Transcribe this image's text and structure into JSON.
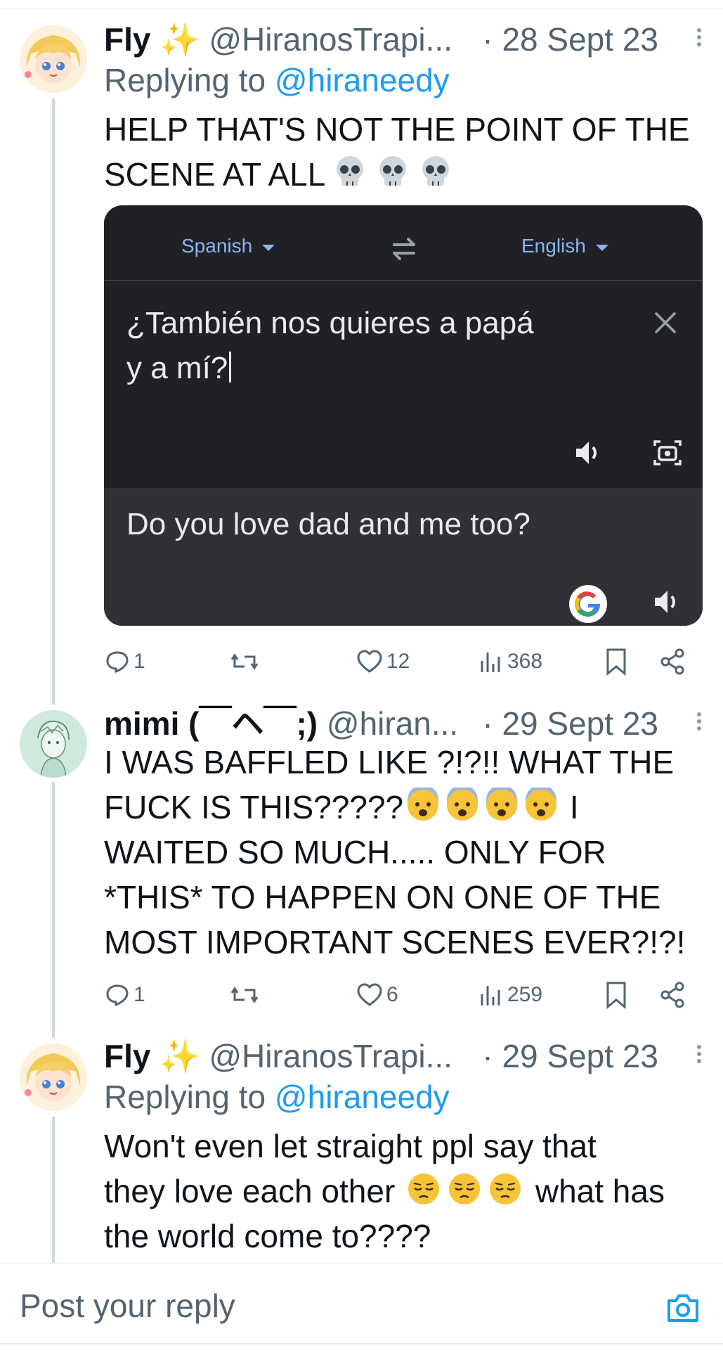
{
  "tweets": [
    {
      "name": "Fly ✨",
      "handle": "@HiranosTrapi...",
      "date": "· 28 Sept 23",
      "reply_label": "Replying to ",
      "reply_handle": "@hiraneedy",
      "text_line1": "HELP THAT'S NOT THE POINT OF THE",
      "text_line2": "SCENE AT ALL",
      "emoji": "skull",
      "stats": {
        "replies": "1",
        "likes": "12",
        "views": "368"
      }
    },
    {
      "name": "mimi (￣ヘ￣;)",
      "handle": "@hiran...",
      "date": "· 29 Sept 23",
      "text_line1": "I WAS BAFFLED LIKE ?!?!! WHAT THE",
      "text_line2a": "FUCK IS THIS?????",
      "text_line2b": " I",
      "text_line3": "WAITED SO MUCH..... ONLY FOR",
      "text_line4": "*THIS* TO HAPPEN ON ONE OF THE",
      "text_line5": "MOST IMPORTANT SCENES EVER?!?!",
      "emoji": "anxious-face",
      "stats": {
        "replies": "1",
        "likes": "6",
        "views": "259"
      }
    },
    {
      "name": "Fly ✨",
      "handle": "@HiranosTrapi...",
      "date": "· 29 Sept 23",
      "reply_label": "Replying to ",
      "reply_handle": "@hiraneedy",
      "text_line1": "Won't even let straight ppl say that",
      "text_line2a": "they love each other ",
      "text_line2b": " what has",
      "text_line3": "the world come to????",
      "emoji": "pensive-face"
    }
  ],
  "translate_card": {
    "source_lang": "Spanish",
    "target_lang": "English",
    "source_line1": "¿También nos quieres a papá",
    "source_line2": "y a mí?",
    "result": "Do you love dad and me too?"
  },
  "composer": {
    "placeholder": "Post your reply"
  },
  "colors": {
    "accent": "#1d9bf0",
    "secondary": "#536471",
    "card_bg": "#202124",
    "card_result_bg": "#303134",
    "translate_blue": "#8ab4f8"
  }
}
